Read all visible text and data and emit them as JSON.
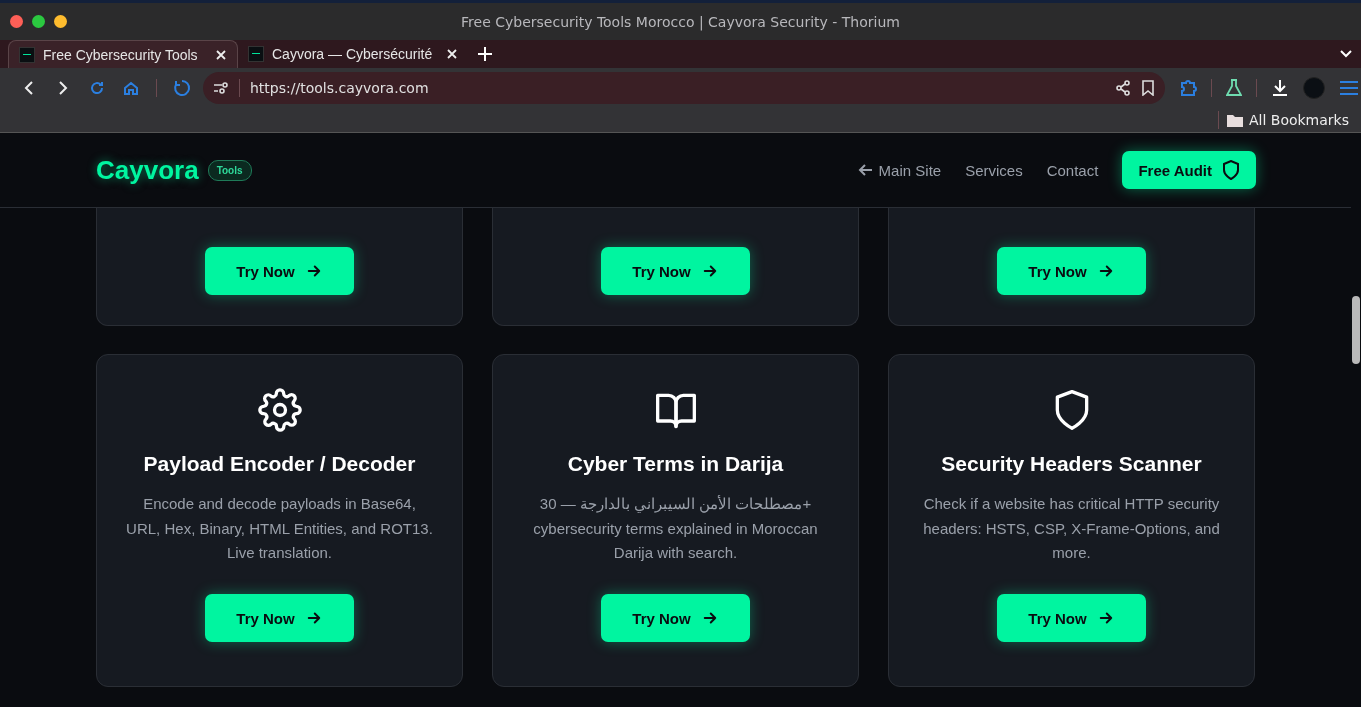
{
  "window": {
    "title": "Free Cybersecurity Tools Morocco | Cayvora Security - Thorium"
  },
  "tabs": [
    {
      "label": "Free Cybersecurity Tools",
      "selected": true
    },
    {
      "label": "Cayvora — Cybersécurité",
      "selected": false
    }
  ],
  "address_bar": {
    "url": "https://tools.cayvora.com"
  },
  "bookmarks_bar": {
    "items": [
      "All Bookmarks"
    ]
  },
  "site_header": {
    "logo": "Cayvora",
    "badge": "Tools",
    "nav": [
      "Main Site",
      "Services",
      "Contact"
    ],
    "cta": "Free Audit"
  },
  "top_cards": [
    {
      "button": "Try Now"
    },
    {
      "button": "Try Now"
    },
    {
      "button": "Try Now"
    }
  ],
  "cards": [
    {
      "kind": "gear",
      "title": "Payload Encoder / Decoder",
      "description": "Encode and decode payloads in Base64, URL, Hex, Binary, HTML Entities, and ROT13. Live translation.",
      "button": "Try Now"
    },
    {
      "kind": "book",
      "title": "Cyber Terms in Darija",
      "description": "مصطلحات الأمن السيبراني بالدارجة — 30+ cybersecurity terms explained in Moroccan Darija with search.",
      "button": "Try Now"
    },
    {
      "kind": "shield",
      "title": "Security Headers Scanner",
      "description": "Check if a website has critical HTTP security headers: HSTS, CSP, X-Frame-Options, and more.",
      "button": "Try Now"
    }
  ]
}
